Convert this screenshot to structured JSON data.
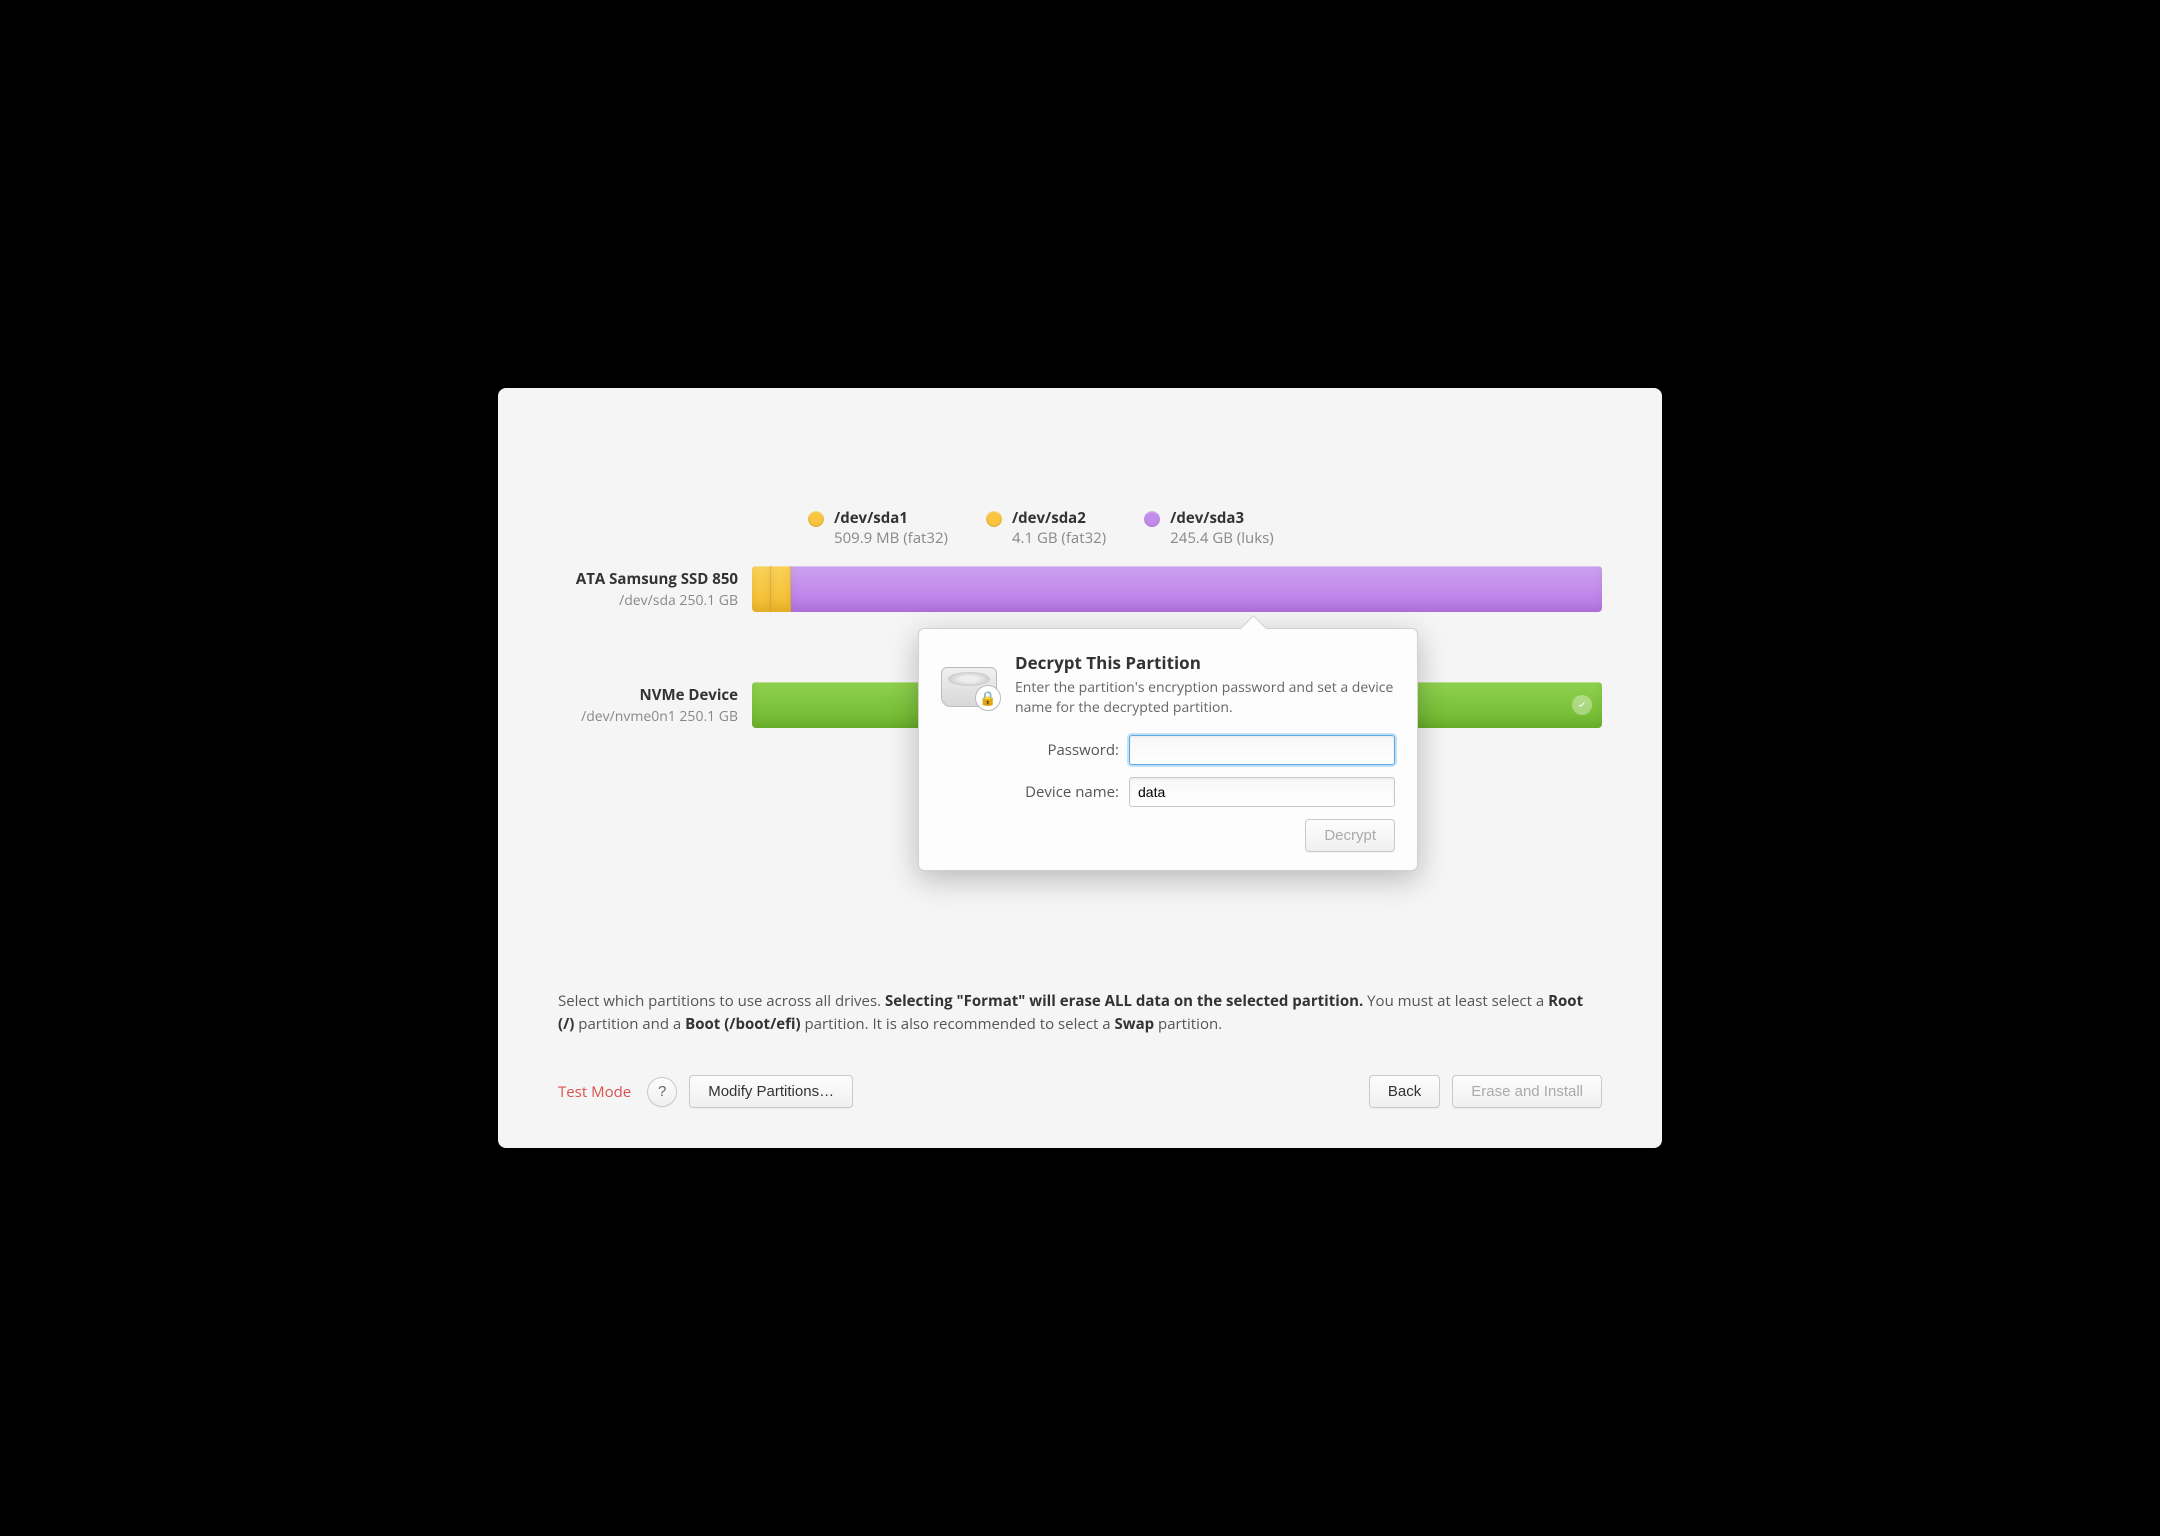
{
  "legend": [
    {
      "color": "yellow",
      "dev": "/dev/sda1",
      "sub": "509.9 MB (fat32)"
    },
    {
      "color": "yellow",
      "dev": "/dev/sda2",
      "sub": "4.1 GB (fat32)"
    },
    {
      "color": "purple",
      "dev": "/dev/sda3",
      "sub": "245.4 GB (luks)"
    }
  ],
  "disks": {
    "d1": {
      "name": "ATA Samsung SSD 850",
      "path": "/dev/sda 250.1 GB"
    },
    "d2": {
      "name": "NVMe Device",
      "path": "/dev/nvme0n1 250.1 GB"
    }
  },
  "help": {
    "prefix": "Select which partitions to use across all drives. ",
    "bold1": "Selecting \"Format\" will erase ALL data on the selected partition.",
    "mid1": " You must at least select a ",
    "bold2": "Root (/)",
    "mid2": " partition and a ",
    "bold3": "Boot (/boot/efi)",
    "mid3": " partition. It is also recommended to select a ",
    "bold4": "Swap",
    "suffix": " partition."
  },
  "footer": {
    "test_mode": "Test Mode",
    "help_btn": "?",
    "modify": "Modify Partitions…",
    "back": "Back",
    "erase": "Erase and Install"
  },
  "popover": {
    "title": "Decrypt This Partition",
    "desc": "Enter the partition's encryption password and set a device name for the decrypted partition.",
    "password_label": "Password:",
    "password_value": "",
    "device_label": "Device name:",
    "device_value": "data",
    "decrypt_btn": "Decrypt"
  }
}
